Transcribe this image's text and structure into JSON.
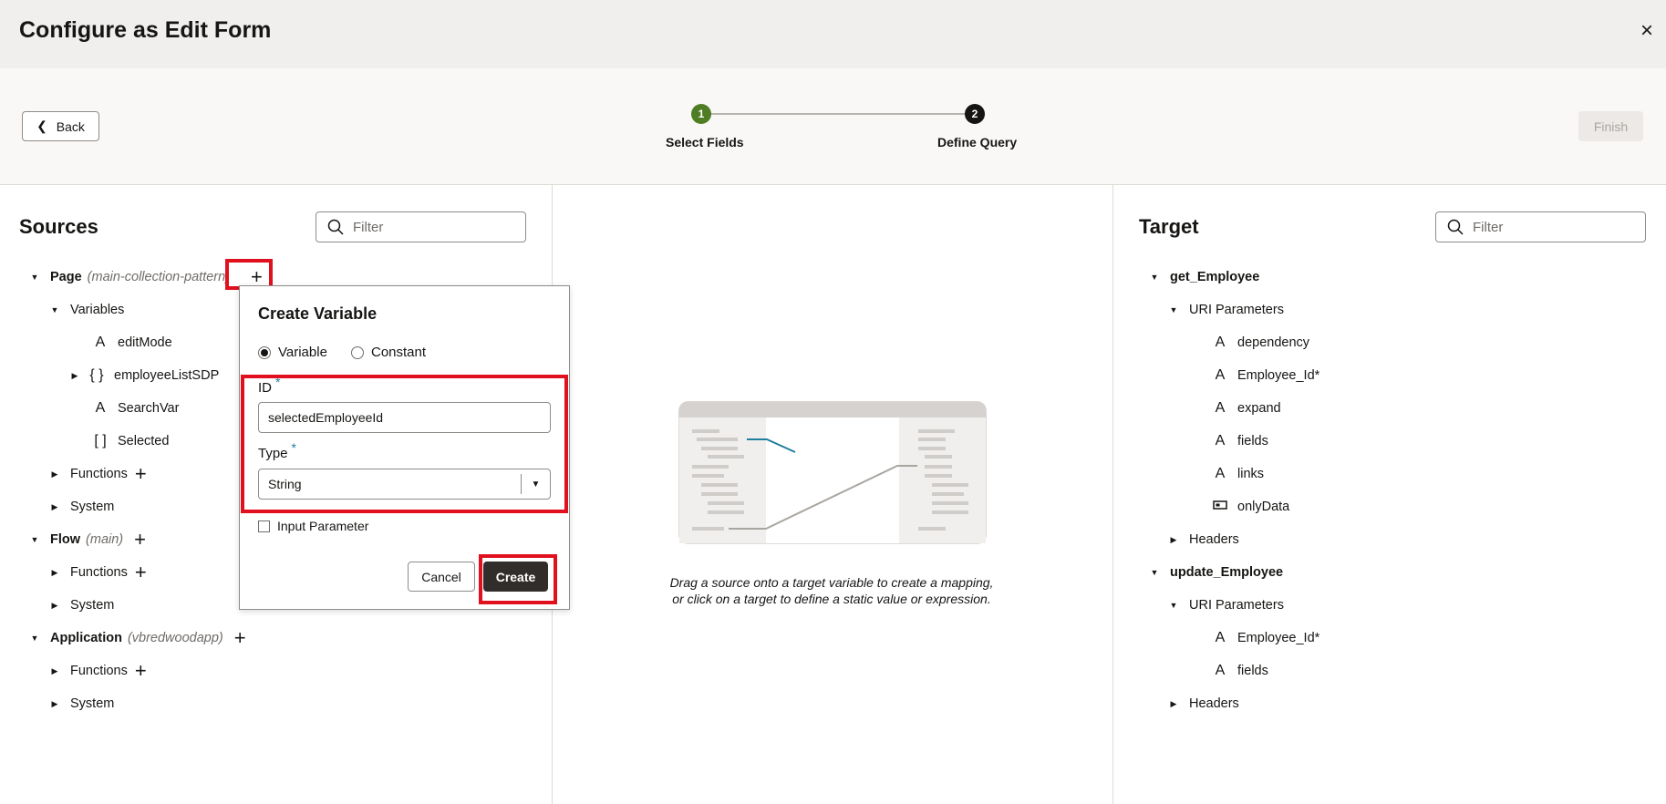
{
  "dialog": {
    "title": "Configure as Edit Form",
    "close_icon": "×"
  },
  "toolbar": {
    "back_label": "Back",
    "finish_label": "Finish",
    "steps": [
      {
        "number": "1",
        "label": "Select Fields"
      },
      {
        "number": "2",
        "label": "Define Query"
      }
    ]
  },
  "sources": {
    "title": "Sources",
    "filter_placeholder": "Filter",
    "tree": [
      {
        "label": "Page",
        "detail": "(main-collection-pattern)"
      },
      {
        "label": "Variables"
      },
      {
        "label": "editMode",
        "icon": "A"
      },
      {
        "label": "employeeListSDP",
        "icon": "{ }"
      },
      {
        "label": "SearchVar",
        "icon": "A"
      },
      {
        "label": "Selected",
        "icon": "[ ]"
      },
      {
        "label": "Functions"
      },
      {
        "label": "System"
      },
      {
        "label": "Flow",
        "detail": "(main)"
      },
      {
        "label": "Functions"
      },
      {
        "label": "System"
      },
      {
        "label": "Application",
        "detail": "(vbredwoodapp)"
      },
      {
        "label": "Functions"
      },
      {
        "label": "System"
      }
    ]
  },
  "popup": {
    "title": "Create Variable",
    "radio_variable": "Variable",
    "radio_constant": "Constant",
    "id_label": "ID",
    "id_value": "selectedEmployeeId",
    "type_label": "Type",
    "type_value": "String",
    "required_marker": "*",
    "input_parameter_label": "Input Parameter",
    "cancel_label": "Cancel",
    "create_label": "Create"
  },
  "mapping": {
    "hint_line1": "Drag a source onto a target variable to create a mapping,",
    "hint_line2": "or click on a target to define a static value or expression."
  },
  "target": {
    "title": "Target",
    "filter_placeholder": "Filter",
    "tree": [
      {
        "label": "get_Employee"
      },
      {
        "label": "URI Parameters"
      },
      {
        "label": "dependency",
        "icon": "A"
      },
      {
        "label": "Employee_Id*",
        "icon": "A"
      },
      {
        "label": "expand",
        "icon": "A"
      },
      {
        "label": "fields",
        "icon": "A"
      },
      {
        "label": "links",
        "icon": "A"
      },
      {
        "label": "onlyData",
        "icon": "toggle"
      },
      {
        "label": "Headers"
      },
      {
        "label": "update_Employee"
      },
      {
        "label": "URI Parameters"
      },
      {
        "label": "Employee_Id*",
        "icon": "A"
      },
      {
        "label": "fields",
        "icon": "A"
      },
      {
        "label": "Headers"
      }
    ]
  },
  "colors": {
    "accent_red": "#e0101e",
    "step_complete": "#4f7d23",
    "step_current": "#161513",
    "required": "#227e9e"
  }
}
